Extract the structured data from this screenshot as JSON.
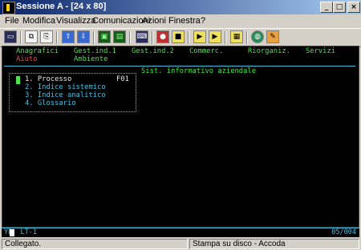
{
  "window": {
    "title": "Sessione A - [24 x 80]",
    "min_glyph": "_",
    "max_glyph": "□",
    "close_glyph": "×"
  },
  "menu": [
    "File",
    "Modifica",
    "Visualizza",
    "Comunicazioni",
    "Azioni",
    "Finestra",
    "?"
  ],
  "toolbar": {
    "buttons": [
      {
        "name": "session-icon",
        "glyph": "▭"
      },
      {
        "name": "copy-icon",
        "glyph": "⧉"
      },
      {
        "name": "paste-icon",
        "glyph": "⎘"
      },
      {
        "name": "send-file-icon",
        "glyph": "⇪"
      },
      {
        "name": "receive-file-icon",
        "glyph": "⇩"
      },
      {
        "name": "display-icon",
        "glyph": "▣"
      },
      {
        "name": "keyboard-icon",
        "glyph": "▤"
      },
      {
        "name": "macro-icon",
        "glyph": "⌨"
      },
      {
        "name": "record-macro-icon",
        "glyph": "●"
      },
      {
        "name": "stop-macro-icon",
        "glyph": "■"
      },
      {
        "name": "play-macro-icon",
        "glyph": "▶"
      },
      {
        "name": "play-macro-2-icon",
        "glyph": "▶"
      },
      {
        "name": "clipboard-icon",
        "glyph": "▦"
      },
      {
        "name": "globe-icon",
        "glyph": "◍"
      },
      {
        "name": "tools-icon",
        "glyph": "✎"
      }
    ]
  },
  "terminal": {
    "menu_row1": [
      "Anagrafici",
      "Gest.ind.1",
      "Gest.ind.2",
      "Commerc.",
      "Riorganiz.",
      "Servizi"
    ],
    "menu_row2": [
      "Aiuto",
      "Ambiente"
    ],
    "panel_title": "Sist. informativo aziendale",
    "items": [
      "1. Processo",
      "2. Indice sistemico",
      "3. Indice analitico",
      "4. Glossario"
    ],
    "function_key": "F01"
  },
  "oia": {
    "status": "YB  LT-1",
    "position": "05/004"
  },
  "statusbar": {
    "left": "Collegato.",
    "right": "Stampa su disco - Accoda"
  }
}
